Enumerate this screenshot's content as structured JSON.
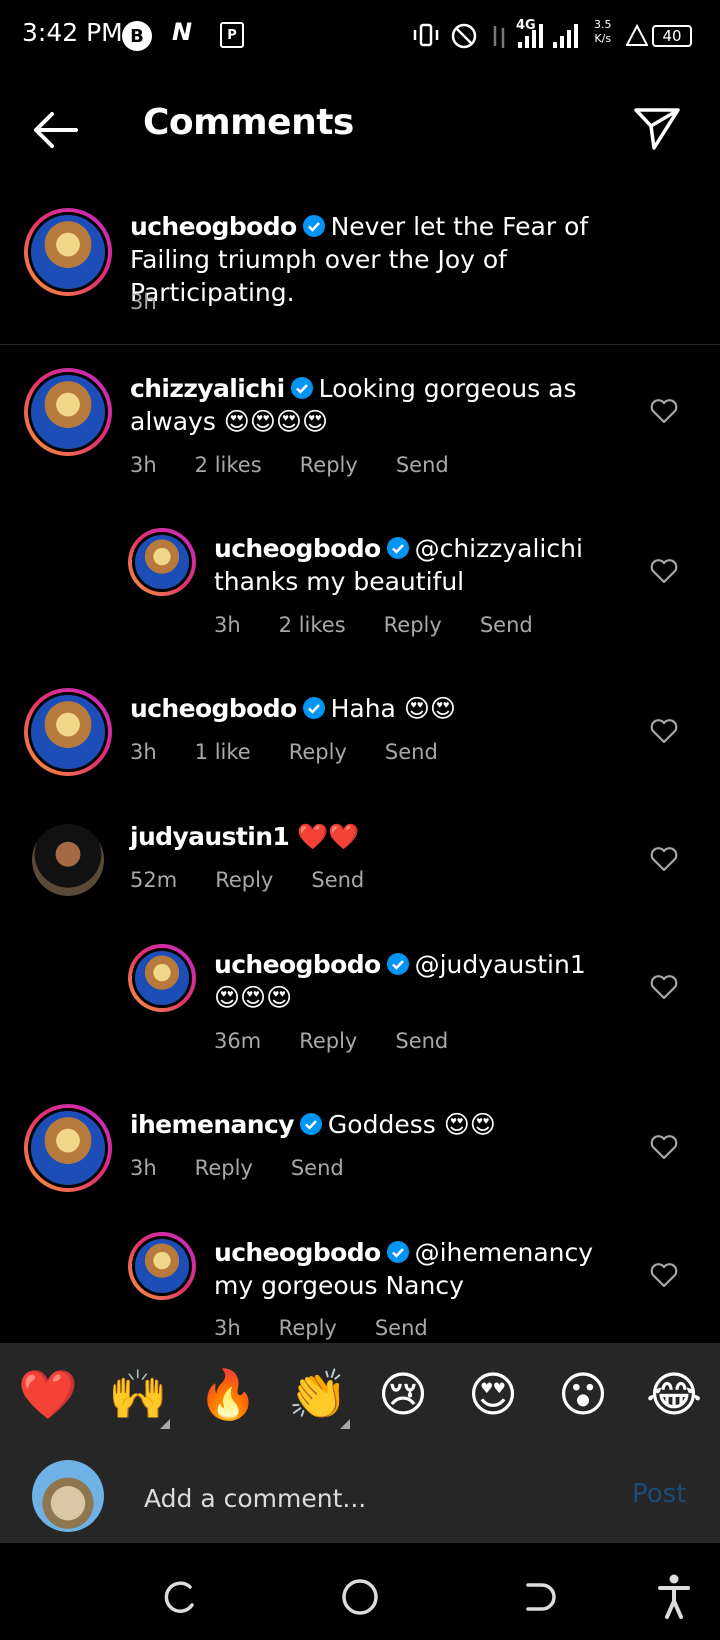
{
  "status_bar": {
    "time": "3:42 PM",
    "badge_b": "B",
    "badge_n": "N",
    "badge_p": "P",
    "network": "4G",
    "speed_value": "3.5",
    "speed_unit": "K/s",
    "battery": "40"
  },
  "header": {
    "title": "Comments"
  },
  "comments": [
    {
      "user": "ucheogbodo",
      "text": "Never let the Fear of Failing triumph over the Joy of Participating.",
      "time": "3h"
    },
    {
      "user": "chizzyalichi",
      "text": "Looking gorgeous as always 😍😍😍😍",
      "time": "3h",
      "likes": "2 likes",
      "reply": "Reply",
      "send": "Send"
    },
    {
      "user": "ucheogbodo",
      "text": "@chizzyalichi thanks my beautiful",
      "time": "3h",
      "likes": "2 likes",
      "reply": "Reply",
      "send": "Send"
    },
    {
      "user": "ucheogbodo",
      "text": "Haha 😍😍",
      "time": "3h",
      "likes": "1 like",
      "reply": "Reply",
      "send": "Send"
    },
    {
      "user": "judyaustin1",
      "text": "❤️❤️",
      "time": "52m",
      "reply": "Reply",
      "send": "Send"
    },
    {
      "user": "ucheogbodo",
      "text": "@judyaustin1 😍😍😍",
      "time": "36m",
      "reply": "Reply",
      "send": "Send"
    },
    {
      "user": "ihemenancy",
      "text": "Goddess 😍😍",
      "time": "3h",
      "reply": "Reply",
      "send": "Send"
    },
    {
      "user": "ucheogbodo",
      "text": "@ihemenancy my gorgeous Nancy",
      "time": "3h",
      "reply": "Reply",
      "send": "Send"
    }
  ],
  "quick_emojis": [
    "❤️",
    "🙌",
    "🔥",
    "👏",
    "😢",
    "😍",
    "😮",
    "😂"
  ],
  "compose": {
    "placeholder": "Add a comment...",
    "post_label": "Post"
  },
  "colors": {
    "background": "#000000",
    "panel": "#262626",
    "verified": "#0095f6",
    "post_disabled": "#1a4c7a",
    "meta_text": "#a8a8a8"
  }
}
